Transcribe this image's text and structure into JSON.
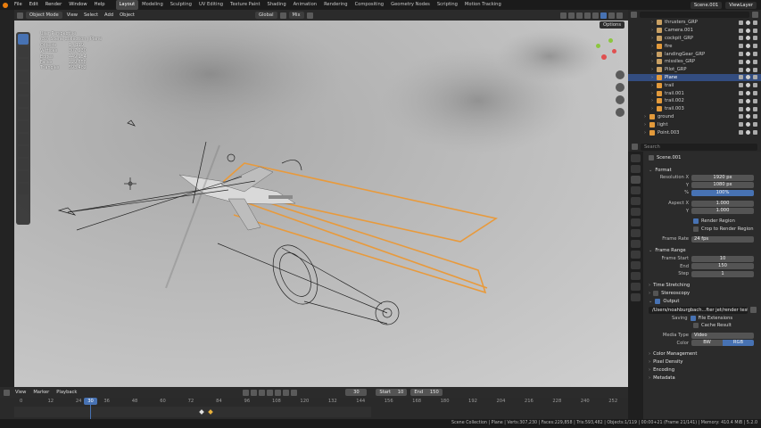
{
  "topbar": {
    "menus": [
      "File",
      "Edit",
      "Render",
      "Window",
      "Help"
    ],
    "workspaces": [
      "Layout",
      "Modeling",
      "Sculpting",
      "UV Editing",
      "Texture Paint",
      "Shading",
      "Animation",
      "Rendering",
      "Compositing",
      "Geometry Nodes",
      "Scripting",
      "Motion Tracking"
    ],
    "active_workspace": "Layout",
    "scene_name": "Scene.001",
    "view_layer": "ViewLayer"
  },
  "viewport_header": {
    "mode": "Object Mode",
    "menus": [
      "View",
      "Select",
      "Add",
      "Object"
    ],
    "orientation": "Global",
    "pivot": "Mix",
    "options": "Options"
  },
  "viewport": {
    "view_name": "User Perspective",
    "collection": "(30) Scene Collection | Plane",
    "stats": [
      [
        "Objects",
        "1 / 119"
      ],
      [
        "Vertices",
        "307,230"
      ],
      [
        "Edges",
        "449,154"
      ],
      [
        "Faces",
        "229,858"
      ],
      [
        "Triangles",
        "593,482"
      ]
    ]
  },
  "outliner": {
    "search_placeholder": "",
    "items": [
      {
        "name": "thrusters_GRP",
        "sel": false,
        "color": "#c9a063"
      },
      {
        "name": "Camera.001",
        "sel": false,
        "color": "#c9a063"
      },
      {
        "name": "cockpit_GRP",
        "sel": false,
        "color": "#c9a063"
      },
      {
        "name": "fire",
        "sel": false,
        "color": "#e39a3b"
      },
      {
        "name": "landingGear_GRP",
        "sel": false,
        "color": "#c9a063"
      },
      {
        "name": "missiles_GRP",
        "sel": false,
        "color": "#c9a063"
      },
      {
        "name": "Pilot_GRP",
        "sel": false,
        "color": "#c9a063"
      },
      {
        "name": "Plane",
        "sel": true,
        "color": "#e39a3b"
      },
      {
        "name": "trail",
        "sel": false,
        "color": "#e39a3b"
      },
      {
        "name": "trail.001",
        "sel": false,
        "color": "#e39a3b"
      },
      {
        "name": "trail.002",
        "sel": false,
        "color": "#e39a3b"
      },
      {
        "name": "trail.003",
        "sel": false,
        "color": "#e39a3b"
      },
      {
        "name": "ground",
        "sel": false,
        "color": "#e39a3b"
      },
      {
        "name": "light",
        "sel": false,
        "color": "#e39a3b"
      },
      {
        "name": "Point.003",
        "sel": false,
        "color": "#e39a3b"
      }
    ]
  },
  "properties": {
    "search_placeholder": "Search",
    "scene_name": "Scene.001",
    "format": {
      "title": "Format",
      "res_x_label": "Resolution X",
      "res_x": "1920 px",
      "res_y_label": "Y",
      "res_y": "1080 px",
      "res_pct_label": "%",
      "res_pct": "100%",
      "aspect_x_label": "Aspect X",
      "aspect_x": "1.000",
      "aspect_y_label": "Y",
      "aspect_y": "1.000",
      "render_region": "Render Region",
      "crop_region": "Crop to Render Region",
      "frame_rate_label": "Frame Rate",
      "frame_rate": "24 fps"
    },
    "frame_range": {
      "title": "Frame Range",
      "start_label": "Frame Start",
      "start": "10",
      "end_label": "End",
      "end": "150",
      "step_label": "Step",
      "step": "1"
    },
    "collapsed": [
      "Time Stretching",
      "Stereoscopy"
    ],
    "output": {
      "title": "Output",
      "path": "/Users/noahburgbach...fter jet/render test/4/",
      "saving_label": "Saving",
      "file_ext": "File Extensions",
      "cache_result": "Cache Result",
      "media_type_label": "Media Type",
      "media_type": "Video",
      "color_label": "Color",
      "color_bw": "BW",
      "color_rgb": "RGB"
    },
    "collapsed2": [
      "Color Management",
      "Pixel Density",
      "Encoding",
      "Metadata"
    ]
  },
  "timeline": {
    "menus": [
      "View",
      "Marker",
      "Playback"
    ],
    "current_frame": "30",
    "start_label": "Start",
    "start": "10",
    "end_label": "End",
    "end": "150",
    "ticks": [
      "0",
      "12",
      "24",
      "30",
      "36",
      "48",
      "60",
      "72",
      "84",
      "96",
      "108",
      "120",
      "132",
      "144",
      "156",
      "168",
      "180",
      "192",
      "204",
      "216",
      "228",
      "240",
      "252"
    ]
  },
  "statusbar": {
    "text": "Scene Collection | Plane | Verts:307,230 | Faces:229,858 | Tris:593,482 | Objects:1/119 | 00:00+21 (Frame 21/141) | Memory: 410.4 MiB | 5.2.0"
  },
  "colors": {
    "selection": "#e89a3c",
    "accent": "#4772b3",
    "sky": "#c2c2c2"
  }
}
